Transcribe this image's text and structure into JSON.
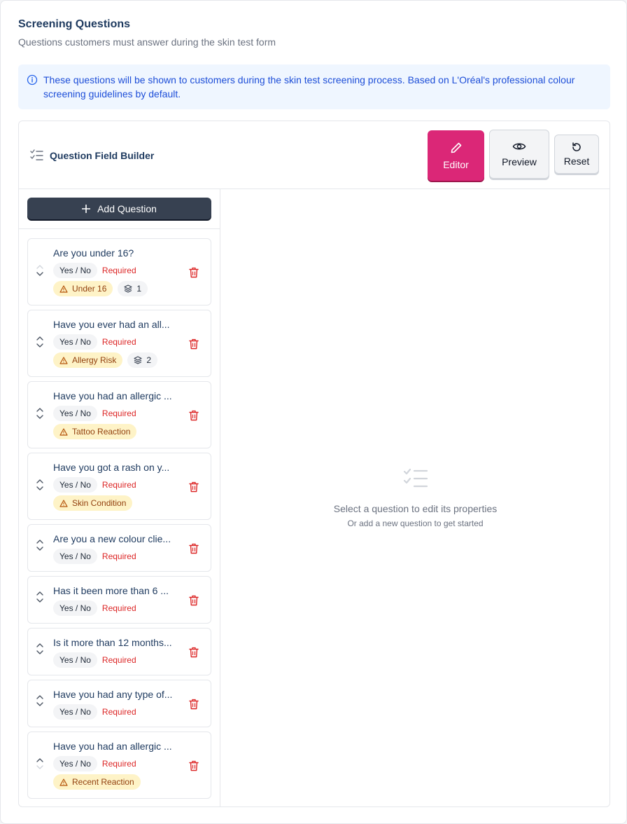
{
  "header": {
    "title": "Screening Questions",
    "subtitle": "Questions customers must answer during the skin test form"
  },
  "info": {
    "text": "These questions will be shown to customers during the skin test screening process. Based on L'Oréal's professional colour screening guidelines by default."
  },
  "builder": {
    "title": "Question Field Builder",
    "modes": {
      "editor": "Editor",
      "preview": "Preview",
      "reset": "Reset"
    },
    "add_label": "Add Question"
  },
  "questions": [
    {
      "text": "Are you under 16?",
      "type": "Yes / No",
      "required": "Required",
      "tag": "Under 16",
      "count": "1"
    },
    {
      "text": "Have you ever had an all...",
      "type": "Yes / No",
      "required": "Required",
      "tag": "Allergy Risk",
      "count": "2"
    },
    {
      "text": "Have you had an allergic ...",
      "type": "Yes / No",
      "required": "Required",
      "tag": "Tattoo Reaction"
    },
    {
      "text": "Have you got a rash on y...",
      "type": "Yes / No",
      "required": "Required",
      "tag": "Skin Condition"
    },
    {
      "text": "Are you a new colour clie...",
      "type": "Yes / No",
      "required": "Required"
    },
    {
      "text": "Has it been more than 6 ...",
      "type": "Yes / No",
      "required": "Required"
    },
    {
      "text": "Is it more than 12 months...",
      "type": "Yes / No",
      "required": "Required"
    },
    {
      "text": "Have you had any type of...",
      "type": "Yes / No",
      "required": "Required"
    },
    {
      "text": "Have you had an allergic ...",
      "type": "Yes / No",
      "required": "Required",
      "tag": "Recent Reaction"
    }
  ],
  "empty_state": {
    "title": "Select a question to edit its properties",
    "subtitle": "Or add a new question to get started"
  },
  "colors": {
    "accent": "#db2777",
    "info_bg": "#eff6ff",
    "info_text": "#1d4ed8",
    "required": "#dc2626",
    "tag_bg": "#fef3c7"
  }
}
